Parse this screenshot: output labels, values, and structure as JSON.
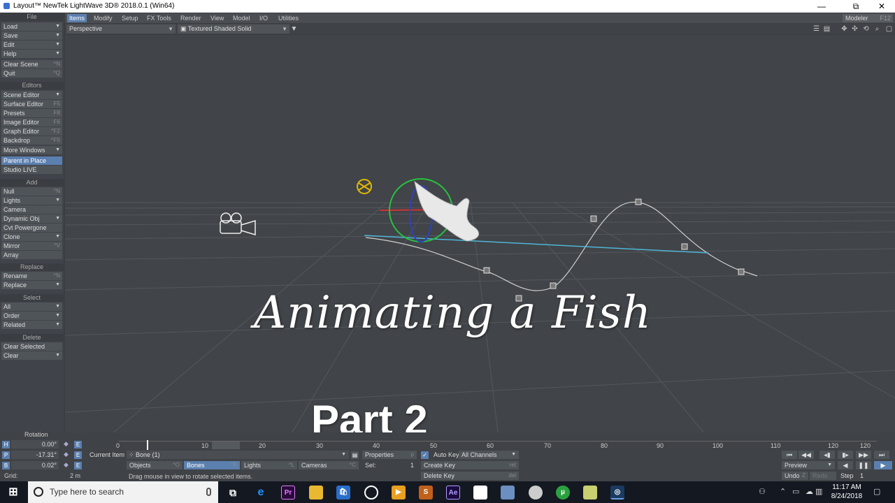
{
  "window": {
    "title": "Layout™ NewTek LightWave 3D® 2018.0.1 (Win64)",
    "controls": [
      "—",
      "⧉",
      "✕"
    ]
  },
  "tabs": [
    {
      "label": "Items"
    },
    {
      "label": "Modify"
    },
    {
      "label": "Setup"
    },
    {
      "label": "FX Tools"
    },
    {
      "label": "Render"
    },
    {
      "label": "View"
    },
    {
      "label": "Model"
    },
    {
      "label": "I/O"
    },
    {
      "label": "Utilities"
    }
  ],
  "modeler": {
    "label": "Modeler",
    "key": "F12"
  },
  "viewport_bar": {
    "view": "Perspective",
    "shading": "Textured Shaded Solid"
  },
  "sidebar": {
    "file": {
      "header": "File",
      "items": [
        {
          "label": "Load"
        },
        {
          "label": "Save"
        },
        {
          "label": "Edit"
        },
        {
          "label": "Help"
        },
        {
          "label": "Clear Scene",
          "key": "^N"
        },
        {
          "label": "Quit",
          "key": "^Q"
        }
      ]
    },
    "editors": {
      "header": "Editors",
      "items": [
        {
          "label": "Scene Editor"
        },
        {
          "label": "Surface Editor",
          "key": "F5"
        },
        {
          "label": "Presets",
          "key": "F8"
        },
        {
          "label": "Image Editor",
          "key": "F6"
        },
        {
          "label": "Graph Editor",
          "key": "^F2"
        },
        {
          "label": "Backdrop",
          "key": "^F5"
        },
        {
          "label": "More Windows"
        },
        {
          "label": "Parent in Place"
        },
        {
          "label": "Studio LIVE"
        }
      ]
    },
    "add": {
      "header": "Add",
      "items": [
        {
          "label": "Null",
          "key": "^N"
        },
        {
          "label": "Lights"
        },
        {
          "label": "Camera"
        },
        {
          "label": "Dynamic Obj"
        },
        {
          "label": "Cvt Powergone"
        },
        {
          "label": "Clone"
        },
        {
          "label": "Mirror",
          "key": "^V"
        },
        {
          "label": "Array"
        }
      ]
    },
    "replace": {
      "header": "Replace",
      "items": [
        {
          "label": "Rename",
          "key": "^N"
        },
        {
          "label": "Replace"
        }
      ]
    },
    "select": {
      "header": "Select",
      "items": [
        {
          "label": "All"
        },
        {
          "label": "Order"
        },
        {
          "label": "Related"
        }
      ]
    },
    "delete": {
      "header": "Delete",
      "items": [
        {
          "label": "Clear Selected"
        },
        {
          "label": "Clear"
        }
      ]
    }
  },
  "overlay": {
    "title": "Animating a Fish",
    "subtitle": "Part 2"
  },
  "bottom": {
    "rotation_label": "Rotation",
    "channels": [
      {
        "axis": "H",
        "value": "0.00°"
      },
      {
        "axis": "P",
        "value": "-17.31°"
      },
      {
        "axis": "B",
        "value": "0.02°"
      }
    ],
    "grid_label": "Grid:",
    "grid_value": "2 m",
    "current_item_label": "Current Item",
    "current_item": "Bone (1)",
    "item_types": [
      {
        "label": "Objects",
        "key": "^O"
      },
      {
        "label": "Bones",
        "key": "^B"
      },
      {
        "label": "Lights",
        "key": "^L"
      },
      {
        "label": "Cameras",
        "key": "^C"
      }
    ],
    "properties": "Properties",
    "properties_key": "p",
    "sel_label": "Sel:",
    "sel_value": "1",
    "auto_key": "Auto Key:",
    "auto_key_mode": "All Channels",
    "create_key": "Create Key",
    "create_key_shortcut": "ret",
    "delete_key": "Delete Key",
    "delete_key_shortcut": "del",
    "status": "Drag mouse in view to rotate selected items.",
    "timeline_ticks": [
      "0",
      "10",
      "15",
      "20",
      "30",
      "40",
      "50",
      "60",
      "70",
      "80",
      "90",
      "100",
      "110",
      "120",
      "120"
    ],
    "preview": "Preview",
    "undo": "Undo",
    "undo_key": "Z",
    "redo": "Redo",
    "step_label": "Step",
    "step_value": "1"
  },
  "taskbar": {
    "search_placeholder": "Type here to search",
    "time": "11:17 AM",
    "date": "8/24/2018"
  }
}
